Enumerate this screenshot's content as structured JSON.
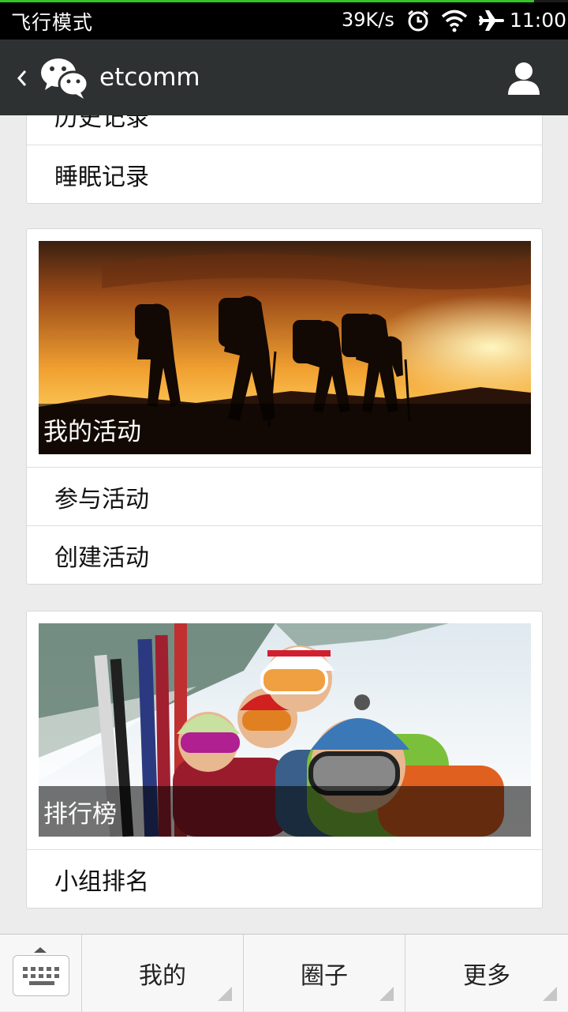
{
  "status_bar": {
    "left_text": "飞行模式",
    "speed": "39K/s",
    "time": "11:00",
    "icons": [
      "alarm-icon",
      "wifi-icon",
      "airplane-icon"
    ]
  },
  "nav": {
    "title": "etcomm",
    "back_icon": "back-arrow-icon",
    "logo_icon": "wechat-logo-icon",
    "profile_icon": "profile-icon"
  },
  "records_card": {
    "items": [
      {
        "label": "历史记录"
      },
      {
        "label": "睡眠记录"
      }
    ]
  },
  "activity_card": {
    "banner_caption": "我的活动",
    "items": [
      {
        "label": "参与活动"
      },
      {
        "label": "创建活动"
      }
    ]
  },
  "ranking_card": {
    "banner_caption": "排行榜",
    "items": [
      {
        "label": "小组排名"
      }
    ]
  },
  "tab_bar": {
    "keyboard_icon": "keyboard-icon",
    "tabs": [
      {
        "label": "我的"
      },
      {
        "label": "圈子"
      },
      {
        "label": "更多"
      }
    ]
  },
  "colors": {
    "nav_bg": "#2e3132",
    "page_bg": "#ececec",
    "progress_accent": "#35c424"
  },
  "loading_progress": 0.94
}
